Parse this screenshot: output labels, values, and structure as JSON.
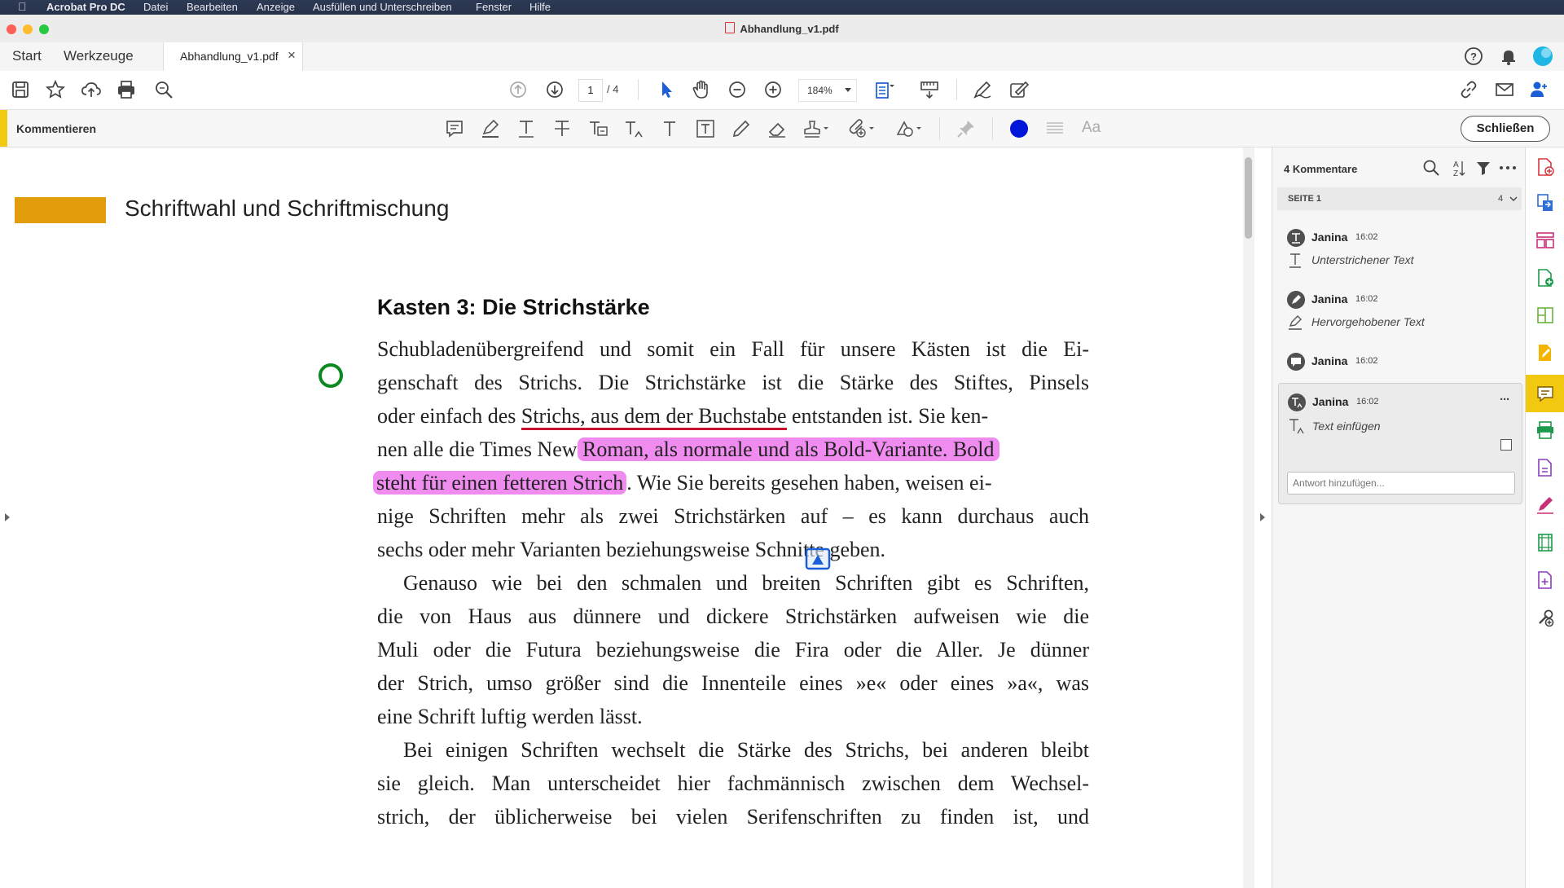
{
  "menubar": {
    "app": "Acrobat Pro DC",
    "items": [
      "Datei",
      "Bearbeiten",
      "Anzeige",
      "Ausfüllen und Unterschreiben",
      "Fenster",
      "Hilfe"
    ]
  },
  "window": {
    "title": "Abhandlung_v1.pdf"
  },
  "tabs": {
    "start": "Start",
    "tools": "Werkzeuge",
    "document": "Abhandlung_v1.pdf",
    "close_glyph": "×"
  },
  "toolbar": {
    "page_current": "1",
    "page_total": "/ 4",
    "zoom": "184%"
  },
  "commentbar": {
    "label": "Kommentieren",
    "font_label": "Aa",
    "close_button": "Schließen",
    "color_selected": "#0016d8"
  },
  "document": {
    "section_title": "Schriftwahl und Schriftmischung",
    "section_bar_color": "#e29d0c",
    "box_heading": "Kasten 3: Die Strichstärke",
    "para1": {
      "line1": "Schubladenübergreifend und somit ein Fall für unsere Kästen ist die Ei-",
      "line2": "genschaft des Strichs. Die Strichstärke ist die Stärke des Stiftes, Pinsels",
      "line3_pre": "oder einfach des ",
      "line3_underlined": "Strichs, aus dem der Buchstabe",
      "line3_post": " entstanden ist. Sie ken-",
      "line4_pre": "nen alle die Times New ",
      "line4_highlight": "Roman, als normale und als Bold-Variante. Bold",
      "line5_highlight": "steht für einen fetteren Strich",
      "line5_post": ". Wie Sie bereits gesehen haben, weisen ei-",
      "line6": "nige Schriften mehr als zwei Strichstärken auf – es kann durchaus auch",
      "line7": "sechs oder mehr Varianten beziehungsweise Schnitte geben."
    },
    "para2": {
      "line1": "Genauso wie bei den schmalen und breiten Schriften gibt es Schriften,",
      "line2": "die von Haus aus dünnere und dickere Strichstärken aufweisen wie die",
      "line3": "Muli oder die Futura beziehungsweise die Fira oder die Aller. Je dünner",
      "line4": "der Strich, umso größer sind die Innenteile eines »e« oder eines »a«, was",
      "line5": "eine Schrift luftig werden lässt."
    },
    "para3": {
      "line1": "Bei einigen Schriften wechselt die Stärke des Strichs, bei anderen bleibt",
      "line2": "sie gleich. Man unterscheidet hier fachmännisch zwischen dem Wechsel-",
      "line3": "strich, der üblicherweise bei vielen Serifenschriften zu finden ist, und"
    },
    "highlight_color": "#f08cf0",
    "underline_color": "#c8102e"
  },
  "panel": {
    "header": "4 Kommentare",
    "page_label": "SEITE 1",
    "page_count": "4",
    "comments": [
      {
        "author": "Janina",
        "time": "16:02",
        "text": "Unterstrichener Text"
      },
      {
        "author": "Janina",
        "time": "16:02",
        "text": "Hervorgehobener Text"
      },
      {
        "author": "Janina",
        "time": "16:02",
        "text": ""
      },
      {
        "author": "Janina",
        "time": "16:02",
        "text": "Text einfügen"
      }
    ],
    "more_glyph": "···",
    "reply_placeholder": "Antwort hinzufügen..."
  }
}
